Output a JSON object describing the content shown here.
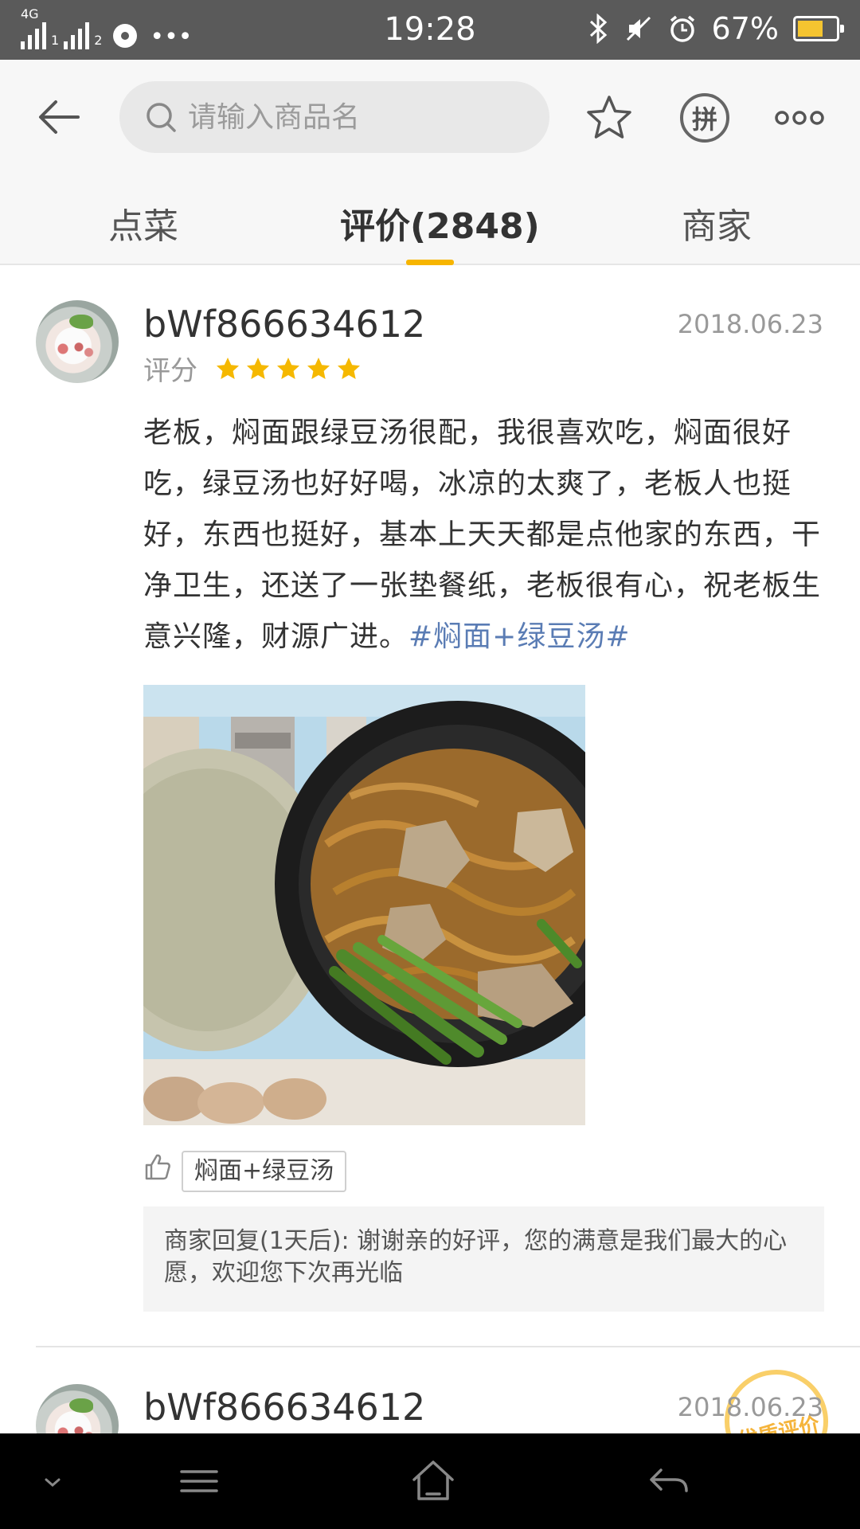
{
  "status_bar": {
    "network_label": "4G",
    "sim1": "1",
    "sim2": "2",
    "more_dots": "•••",
    "time": "19:28",
    "battery_percent": "67%",
    "battery_level": 0.67
  },
  "search": {
    "placeholder": "请输入商品名"
  },
  "header": {
    "pin_label": "拼"
  },
  "tabs": [
    {
      "label": "点菜",
      "active": false
    },
    {
      "label": "评价(2848)",
      "active": true
    },
    {
      "label": "商家",
      "active": false
    }
  ],
  "reviews": [
    {
      "username": "bWf866634612",
      "date": "2018.06.23",
      "rating_label": "评分",
      "stars": 5,
      "text": "老板，焖面跟绿豆汤很配，我很喜欢吃，焖面很好吃，绿豆汤也好好喝，冰凉的太爽了，老板人也挺好，东西也挺好，基本上天天都是点他家的东西，干净卫生，还送了一张垫餐纸，老板很有心，祝老板生意兴隆，财源广进。",
      "hashtag": "#焖面+绿豆汤#",
      "dish_tag": "焖面+绿豆汤",
      "merchant_reply": "商家回复(1天后): 谢谢亲的好评，您的满意是我们最大的心愿，欢迎您下次再光临"
    },
    {
      "username": "bWf866634612",
      "date": "2018.06.23",
      "stamp_label": "优质评价"
    }
  ],
  "colors": {
    "accent": "#f7b500",
    "star": "#f5b800",
    "hashtag": "#5a7cb4",
    "status_bar": "#5a5a5a"
  }
}
